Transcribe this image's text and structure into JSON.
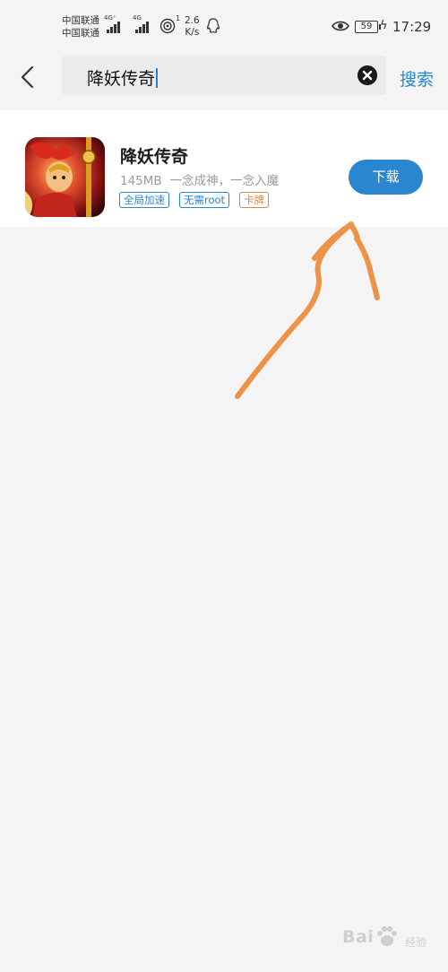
{
  "status_bar": {
    "carrier_1": "中国联通",
    "carrier_2": "中国联通",
    "network_1": "4G⁺",
    "network_2": "4G",
    "hotspot_users": "1",
    "speed_value": "2.6",
    "speed_unit": "K/s",
    "battery": "59",
    "time": "17:29"
  },
  "search": {
    "query": "降妖传奇",
    "submit_label": "搜索"
  },
  "result": {
    "app_name": "降妖传奇",
    "size": "145MB",
    "slogan": "一念成神，一念入魔",
    "tags": [
      "全局加速",
      "无需root",
      "卡牌"
    ],
    "download_label": "下载"
  },
  "watermark": {
    "text": "Bai",
    "sub": "经验"
  },
  "colors": {
    "accent": "#2a86d1",
    "annotation_arrow": "#ee9248",
    "tag_orange": "#e2843c",
    "background": "#f4f4f4"
  },
  "icons": [
    "back-arrow-icon",
    "clear-icon",
    "eye-icon",
    "charging-icon",
    "qq-icon",
    "hotspot-icon"
  ]
}
